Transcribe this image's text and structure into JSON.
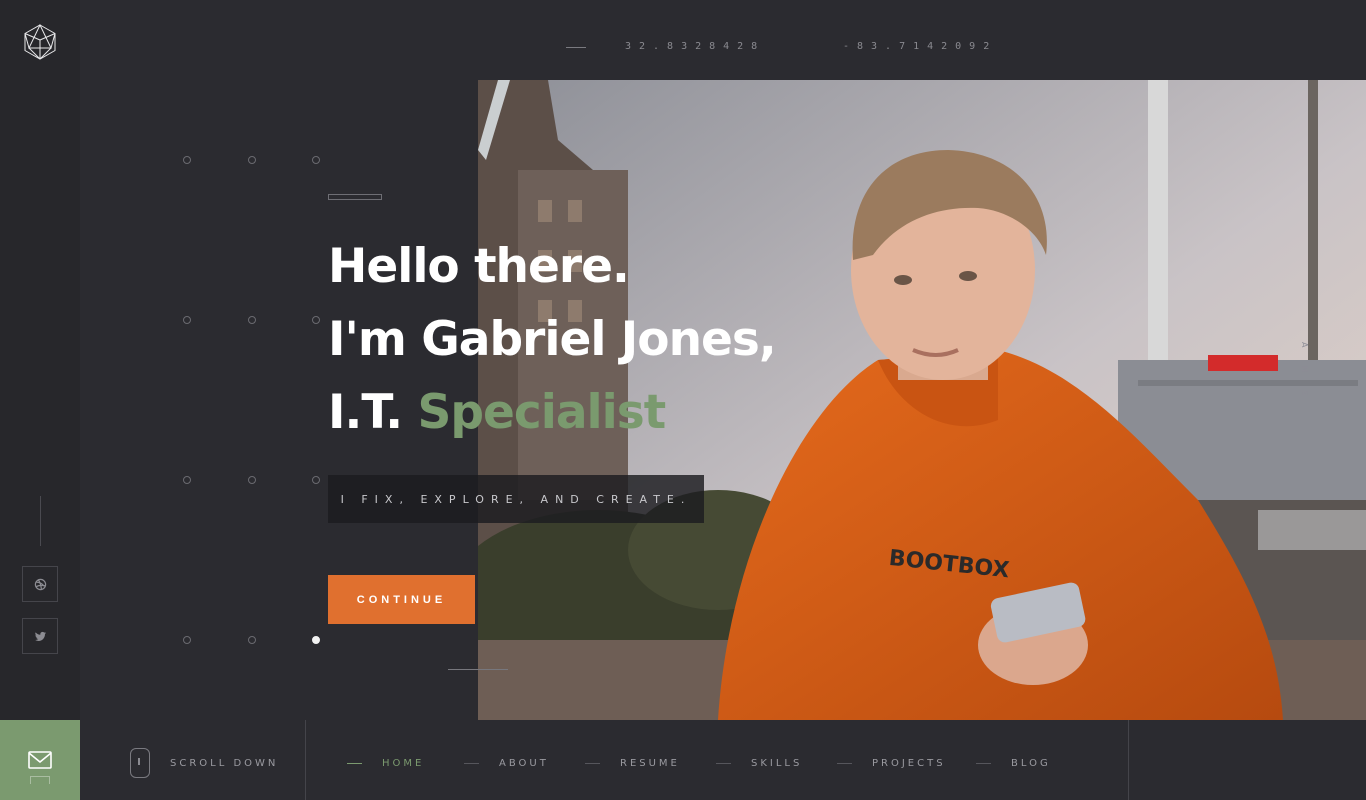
{
  "coordinates": {
    "lat": "32.8328428",
    "lng": "-83.7142092"
  },
  "hero": {
    "line1": "Hello there.",
    "line2": "I'm Gabriel Jones,",
    "line3_prefix": "I.T. ",
    "line3_accent": "Specialist",
    "tagline": "I FIX, EXPLORE, AND CREATE.",
    "cta": "CONTINUE"
  },
  "photo": {
    "side_text": "A N S"
  },
  "social": {
    "items": [
      "dribbble-icon",
      "twitter-icon"
    ]
  },
  "bottom": {
    "scroll_label": "SCROLL DOWN",
    "nav": [
      "HOME",
      "ABOUT",
      "RESUME",
      "SKILLS",
      "PROJECTS",
      "BLOG"
    ],
    "active_nav": "HOME"
  },
  "colors": {
    "accent_green": "#7b9a6f",
    "cta_orange": "#e0702f",
    "background": "#2b2b30"
  }
}
